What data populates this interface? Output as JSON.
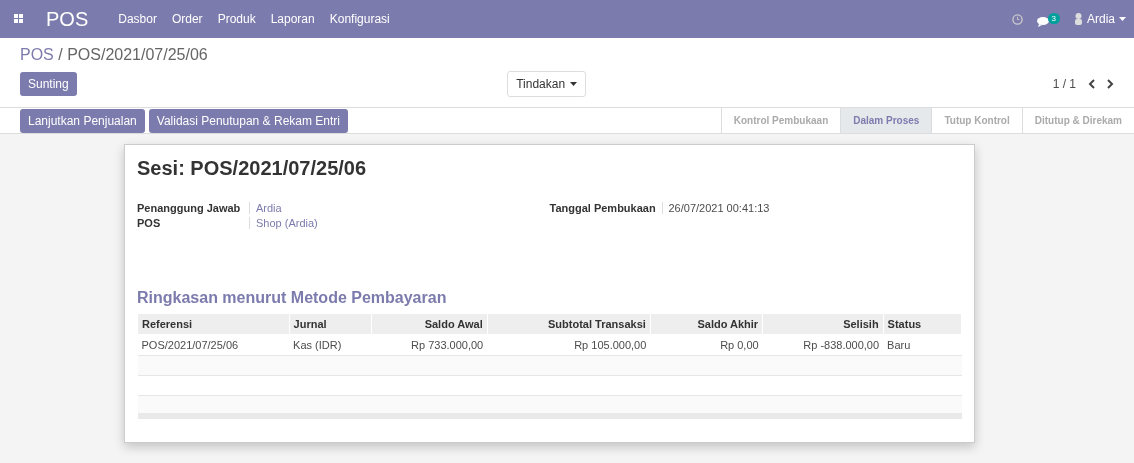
{
  "navbar": {
    "app": "POS",
    "menu": [
      "Dasbor",
      "Order",
      "Produk",
      "Laporan",
      "Konfigurasi"
    ],
    "messages_count": "3",
    "user": "Ardia"
  },
  "breadcrumb": {
    "parent": "POS",
    "separator": "/",
    "current": "POS/2021/07/25/06"
  },
  "edit_button": "Sunting",
  "action_button": "Tindakan",
  "pager": "1 / 1",
  "action_buttons": [
    "Lanjutkan Penjualan",
    "Validasi Penutupan & Rekam Entri"
  ],
  "stages": [
    {
      "label": "Kontrol Pembukaan",
      "selected": false
    },
    {
      "label": "Dalam Proses",
      "selected": true
    },
    {
      "label": "Tutup Kontrol",
      "selected": false
    },
    {
      "label": "Ditutup & Direkam",
      "selected": false
    }
  ],
  "sheet": {
    "title": "Sesi: POS/2021/07/25/06",
    "left_fields": [
      {
        "label": "Penanggung Jawab",
        "value": "Ardia"
      },
      {
        "label": "POS",
        "value": "Shop (Ardia)"
      }
    ],
    "right_fields": [
      {
        "label": "Tanggal Pembukaan",
        "value": "26/07/2021 00:41:13"
      }
    ],
    "section_title": "Ringkasan menurut Metode Pembayaran",
    "table": {
      "columns": [
        "Referensi",
        "Jurnal",
        "Saldo Awal",
        "Subtotal Transaksi",
        "Saldo Akhir",
        "Selisih",
        "Status"
      ],
      "rows": [
        [
          "POS/2021/07/25/06",
          "Kas (IDR)",
          "Rp 733.000,00",
          "Rp 105.000,00",
          "Rp 0,00",
          "Rp -838.000,00",
          "Baru"
        ]
      ]
    }
  }
}
